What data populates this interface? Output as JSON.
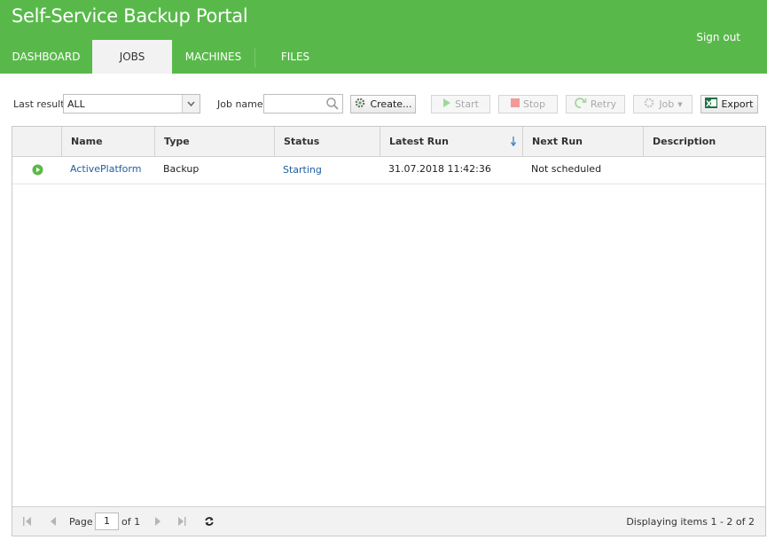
{
  "header": {
    "title": "Self-Service Backup Portal",
    "sign_out": "Sign out",
    "accent_color": "#58b94a",
    "tabs": [
      {
        "label": "DASHBOARD",
        "active": false
      },
      {
        "label": "JOBS",
        "active": true
      },
      {
        "label": "MACHINES",
        "active": false
      },
      {
        "label": "FILES",
        "active": false
      }
    ]
  },
  "toolbar": {
    "last_result_label": "Last result",
    "last_result_value": "ALL",
    "job_name_label": "Job name",
    "job_name_value": "",
    "create_label": "Create...",
    "start_label": "Start",
    "stop_label": "Stop",
    "retry_label": "Retry",
    "job_label": "Job",
    "export_label": "Export"
  },
  "grid": {
    "columns": [
      "Name",
      "Type",
      "Status",
      "Latest Run",
      "Next Run",
      "Description"
    ],
    "sorted_column": "Latest Run",
    "sort_direction": "descending",
    "rows": [
      {
        "name": "ActivePlatform",
        "type": "Backup",
        "status": "Starting",
        "latest_run": "31.07.2018 11:42:36",
        "next_run": "Not scheduled",
        "description": ""
      }
    ]
  },
  "pager": {
    "page_label": "Page",
    "page_value": "1",
    "of_label": "of 1",
    "summary": "Displaying items 1 - 2 of 2"
  }
}
